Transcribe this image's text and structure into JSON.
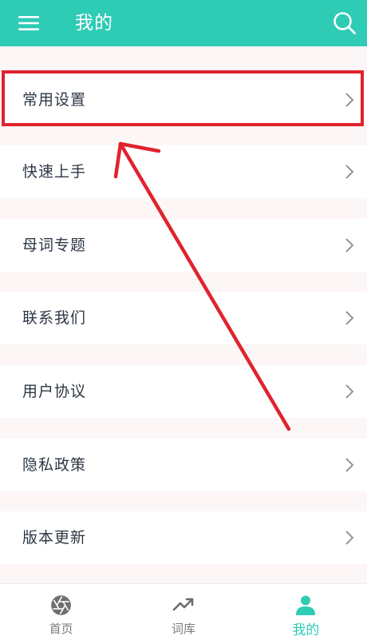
{
  "colors": {
    "accent": "#2ecbb5",
    "annotation_red": "#e0232e"
  },
  "header": {
    "title": "我的",
    "menu_icon": "hamburger-menu-icon",
    "search_icon": "search-icon"
  },
  "menu": {
    "items": [
      {
        "label": "常用设置"
      },
      {
        "label": "快速上手"
      },
      {
        "label": "母词专题"
      },
      {
        "label": "联系我们"
      },
      {
        "label": "用户协议"
      },
      {
        "label": "隐私政策"
      },
      {
        "label": "版本更新"
      }
    ]
  },
  "bottom_nav": {
    "items": [
      {
        "label": "首页",
        "icon": "aperture-icon"
      },
      {
        "label": "词库",
        "icon": "trending-up-icon"
      },
      {
        "label": "我的",
        "icon": "person-icon",
        "active": true
      }
    ]
  }
}
